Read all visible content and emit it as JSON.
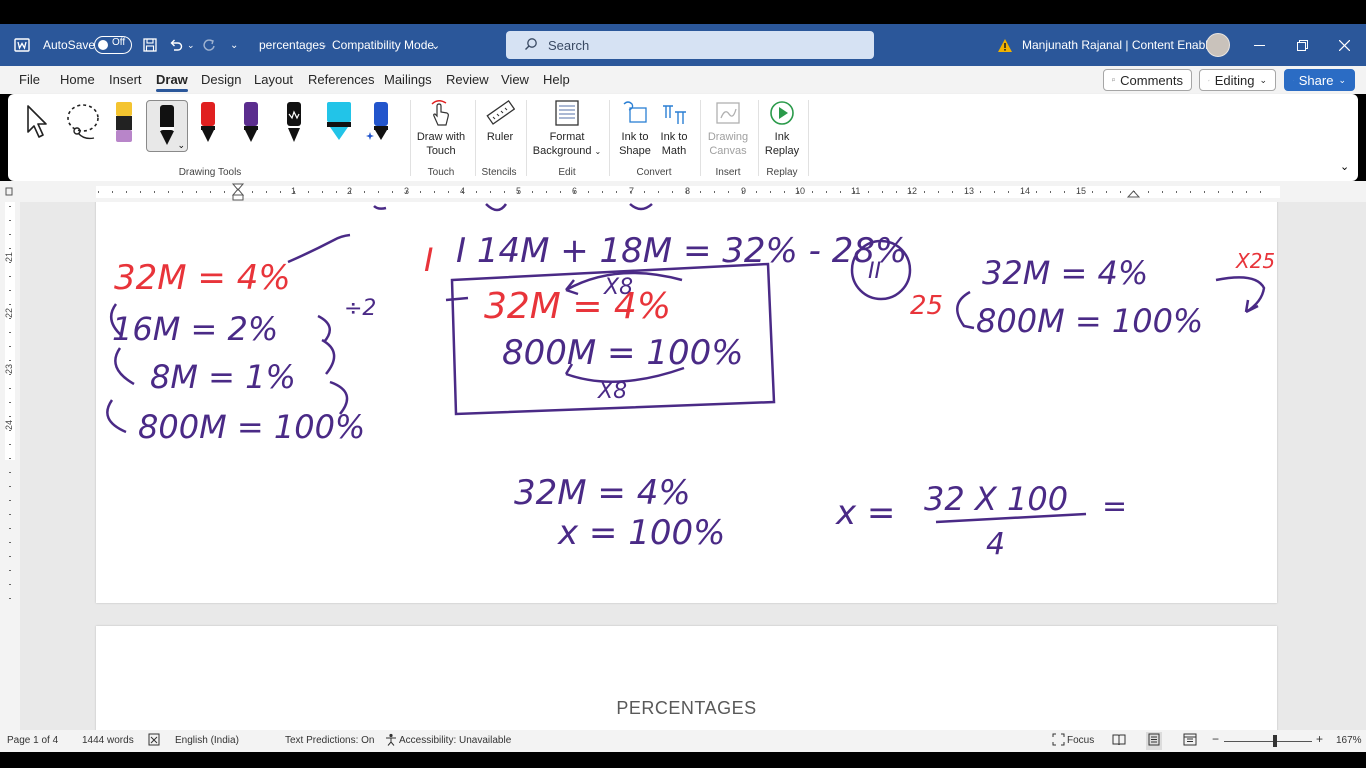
{
  "titlebar": {
    "autosave_label": "AutoSave",
    "autosave_state": "Off",
    "doc_title": "percentages",
    "mode": "Compatibility Mode",
    "search_placeholder": "Search",
    "user": "Manjunath Rajanal | Content Enablers"
  },
  "menu": {
    "tabs": [
      "File",
      "Home",
      "Insert",
      "Draw",
      "Design",
      "Layout",
      "References",
      "Mailings",
      "Review",
      "View",
      "Help"
    ],
    "active_tab": "Draw",
    "comments": "Comments",
    "editing": "Editing",
    "share": "Share"
  },
  "ribbon": {
    "groups": {
      "drawing_tools": "Drawing Tools",
      "touch": "Touch",
      "stencils": "Stencils",
      "edit": "Edit",
      "convert": "Convert",
      "insert": "Insert",
      "replay": "Replay"
    },
    "buttons": {
      "draw_with_touch_1": "Draw with",
      "draw_with_touch_2": "Touch",
      "ruler": "Ruler",
      "format_bg_1": "Format",
      "format_bg_2": "Background",
      "ink_to_shape_1": "Ink to",
      "ink_to_shape_2": "Shape",
      "ink_to_math_1": "Ink to",
      "ink_to_math_2": "Math",
      "drawing_canvas_1": "Drawing",
      "drawing_canvas_2": "Canvas",
      "ink_replay_1": "Ink",
      "ink_replay_2": "Replay"
    },
    "pen_colors": [
      "#f4c430",
      "#000000",
      "#e02020",
      "#5b2d8e",
      "#000000",
      "#22c4e8",
      "#2255cc"
    ]
  },
  "ruler": {
    "h_numbers": [
      "1",
      "2",
      "3",
      "4",
      "5",
      "6",
      "7",
      "8",
      "9",
      "10",
      "11",
      "12",
      "13",
      "14",
      "15"
    ],
    "v_numbers": [
      "21",
      "22",
      "23",
      "24"
    ]
  },
  "ink": {
    "left": {
      "l1": "32M = 4%",
      "l2": "16M = 2%",
      "div2": "÷2",
      "l3": "8M = 1%",
      "l4": "800M = 100%"
    },
    "middle": {
      "top": "I 14M + 18M = 32% - 28%",
      "x8_top": "X8",
      "box1": "32M = 4%",
      "box2": "800M = 100%",
      "x8_bottom": "X8"
    },
    "right": {
      "roman": "II",
      "twentyfive": "25",
      "x25": "X25",
      "l1": "32M = 4%",
      "l2": "800M = 100%"
    },
    "bottom": {
      "a1": "32M = 4%",
      "a2": "x = 100%",
      "x_eq": "x =",
      "numerator": "32 X 100",
      "denominator": "4",
      "trailing": "="
    },
    "colors": {
      "purple": "#4a2a86",
      "red": "#e8343a"
    }
  },
  "page2": {
    "heading": "PERCENTAGES"
  },
  "status": {
    "page": "Page 1 of 4",
    "words": "1444 words",
    "language": "English (India)",
    "predictions": "Text Predictions: On",
    "accessibility": "Accessibility: Unavailable",
    "focus": "Focus",
    "zoom": "167%",
    "zoom_level_percent": 167
  }
}
